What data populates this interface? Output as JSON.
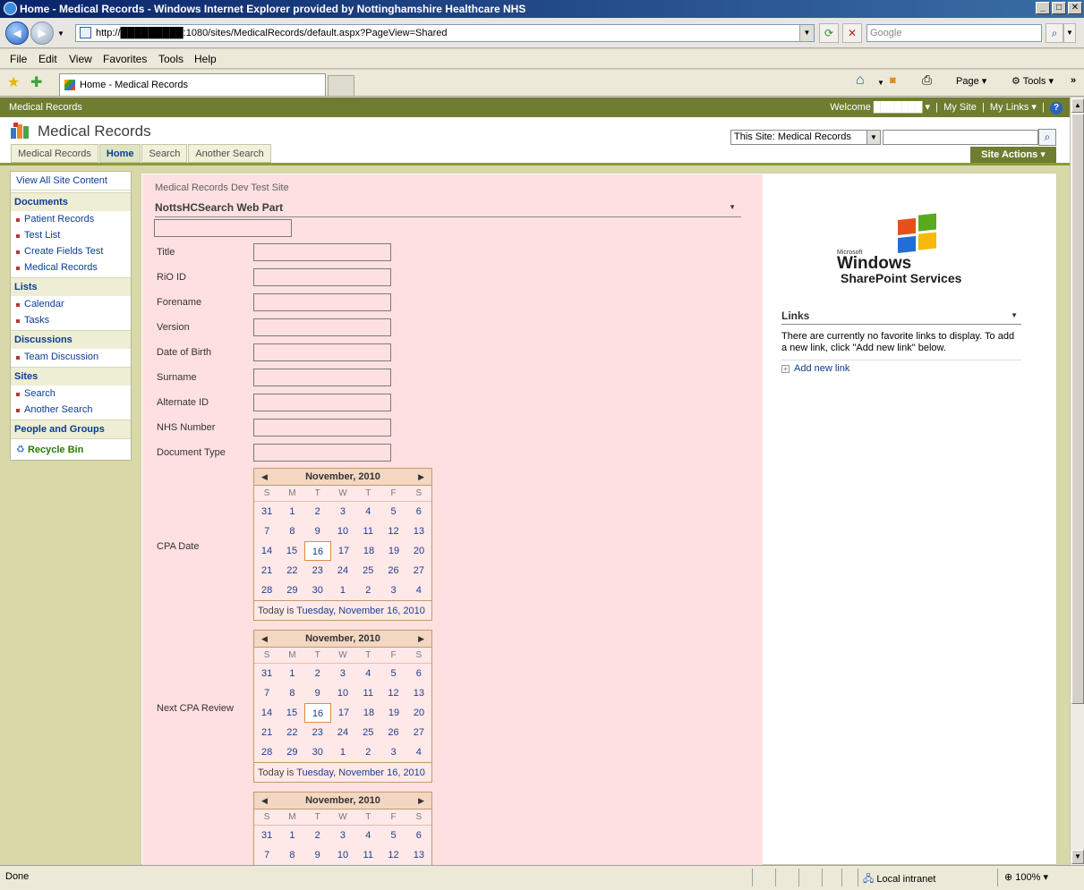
{
  "browser": {
    "title": "Home - Medical Records - Windows Internet Explorer provided by Nottinghamshire Healthcare NHS",
    "address": "http://█████████:1080/sites/MedicalRecords/default.aspx?PageView=Shared",
    "search_placeholder": "Google",
    "menu": [
      "File",
      "Edit",
      "View",
      "Favorites",
      "Tools",
      "Help"
    ],
    "tab_label": "Home - Medical Records",
    "cmd_page": "Page",
    "cmd_tools": "Tools",
    "status": "Done",
    "zone": "Local intranet",
    "zoom": "100%"
  },
  "sharepoint": {
    "top_left": "Medical Records",
    "welcome": "Welcome ███████ ▾",
    "my_site": "My Site",
    "my_links": "My Links ▾",
    "site_title": "Medical Records",
    "scope": "This Site: Medical Records",
    "tabs": [
      "Medical Records",
      "Home",
      "Search",
      "Another Search"
    ],
    "site_actions": "Site Actions ▾"
  },
  "quick_launch": {
    "view_all": "View All Site Content",
    "documents": "Documents",
    "documents_items": [
      "Patient Records",
      "Test List",
      "Create Fields Test",
      "Medical Records"
    ],
    "lists": "Lists",
    "lists_items": [
      "Calendar",
      "Tasks"
    ],
    "discussions": "Discussions",
    "discussions_items": [
      "Team Discussion"
    ],
    "sites": "Sites",
    "sites_items": [
      "Search",
      "Another Search"
    ],
    "people": "People and Groups",
    "recycle": "Recycle Bin"
  },
  "main": {
    "crumb": "Medical Records Dev Test Site",
    "webpart_title": "NottsHCSearch Web Part",
    "fields": [
      "Title",
      "RiO ID",
      "Forename",
      "Version",
      "Date of Birth",
      "Surname",
      "Alternate ID",
      "NHS Number",
      "Document Type"
    ],
    "cpa_date": "CPA Date",
    "next_cpa": "Next CPA Review"
  },
  "calendar": {
    "month": "November, 2010",
    "days": [
      "S",
      "M",
      "T",
      "W",
      "T",
      "F",
      "S"
    ],
    "weeks": [
      [
        "31",
        "1",
        "2",
        "3",
        "4",
        "5",
        "6"
      ],
      [
        "7",
        "8",
        "9",
        "10",
        "11",
        "12",
        "13"
      ],
      [
        "14",
        "15",
        "16",
        "17",
        "18",
        "19",
        "20"
      ],
      [
        "21",
        "22",
        "23",
        "24",
        "25",
        "26",
        "27"
      ],
      [
        "28",
        "29",
        "30",
        "1",
        "2",
        "3",
        "4"
      ]
    ],
    "today_prefix": "Today is ",
    "today_text": "Tuesday, November 16, 2010",
    "selected": "16"
  },
  "links": {
    "title": "Links",
    "empty_text": "There are currently no favorite links to display. To add a new link, click \"Add new link\" below.",
    "add": "Add new link"
  },
  "logo": {
    "microsoft": "Microsoft",
    "windows": "Windows",
    "sps": "SharePoint Services"
  }
}
